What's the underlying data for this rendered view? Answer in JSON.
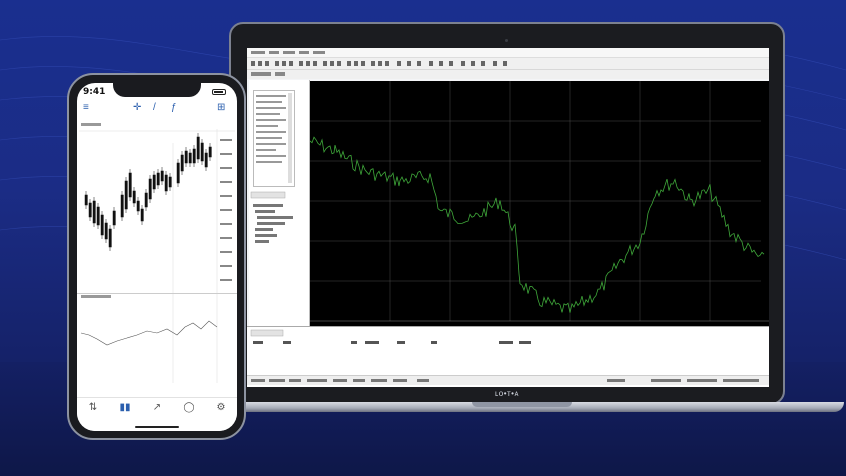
{
  "laptop": {
    "brand_label": "ʟᴏ•ᴛ•ᴀ",
    "chart": {
      "background": "#000000",
      "line_color": "#3fa83a",
      "grid_color": "#4a4a4a"
    }
  },
  "phone": {
    "status_time": "9:41",
    "toolbar": {
      "crosshair_icon": "crosshair-icon",
      "line_tool_icon": "line-tool-icon",
      "indicator_icon": "indicator-icon"
    },
    "candles_color": "#111111",
    "tabs": [
      {
        "icon": "quotes-icon",
        "label": "",
        "active": false
      },
      {
        "icon": "chart-icon",
        "label": "",
        "active": true
      },
      {
        "icon": "trade-icon",
        "label": "",
        "active": false
      },
      {
        "icon": "chat-icon",
        "label": "",
        "active": false
      },
      {
        "icon": "settings-icon",
        "label": "",
        "active": false
      }
    ]
  },
  "colors": {
    "background_top": "#1a2f8f",
    "background_bottom": "#0f1a52",
    "accent": "#2b5fae"
  }
}
